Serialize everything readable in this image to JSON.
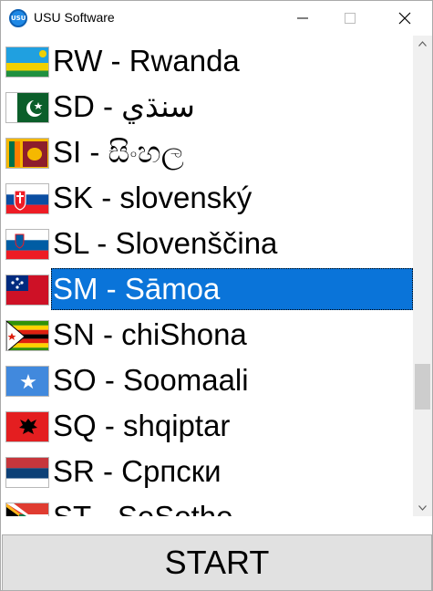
{
  "window": {
    "title": "USU Software",
    "icon_text": "USU"
  },
  "languages": [
    {
      "label": "RW - Rwanda",
      "flag": "rwanda-flag"
    },
    {
      "label": "SD - سنڌي",
      "flag": "pakistan-flag"
    },
    {
      "label": "SI - සිංහල",
      "flag": "sri-lanka-flag"
    },
    {
      "label": "SK - slovenský",
      "flag": "slovakia-flag"
    },
    {
      "label": "SL - Slovenščina",
      "flag": "slovenia-flag"
    },
    {
      "label": "SM - Sāmoa",
      "flag": "samoa-flag",
      "selected": true
    },
    {
      "label": "SN - chiShona",
      "flag": "zimbabwe-flag"
    },
    {
      "label": "SO - Soomaali",
      "flag": "somalia-flag"
    },
    {
      "label": "SQ - shqiptar",
      "flag": "albania-flag"
    },
    {
      "label": "SR - Српски",
      "flag": "serbia-flag"
    },
    {
      "label": "ST - SeSotho",
      "flag": "south-africa-flag"
    }
  ],
  "start_button": {
    "label": "START"
  },
  "colors": {
    "selection": "#0a74d9",
    "button_bg": "#e1e1e1",
    "scroll_track": "#f0f0f0"
  }
}
